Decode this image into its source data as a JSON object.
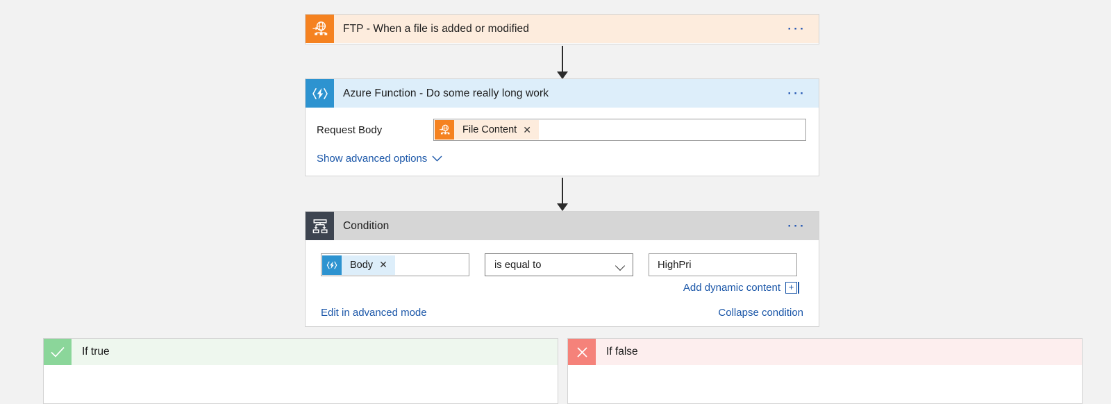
{
  "canvas": {
    "background_color": "#f2f2f2"
  },
  "nodes": {
    "trigger": {
      "title": "FTP - When a file is added or modified",
      "icon": "ftp-globe-icon",
      "icon_color": "#f58220",
      "header_color": "#fdecdd",
      "menu_label": "···"
    },
    "action": {
      "title": "Azure Function - Do some really long work",
      "icon": "azure-function-bolt-icon",
      "icon_color": "#2d93d0",
      "header_color": "#ddeefa",
      "menu_label": "···",
      "request_body_label": "Request Body",
      "request_body_token": "File Content",
      "token_remove_label": "✕",
      "advanced_options_label": "Show advanced options"
    },
    "condition": {
      "title": "Condition",
      "icon": "condition-branch-icon",
      "icon_color": "#3d4450",
      "header_color": "#d6d6d6",
      "menu_label": "···",
      "left_token": "Body",
      "token_remove_label": "✕",
      "operator": "is equal to",
      "value": "HighPri",
      "add_dynamic_content_label": "Add dynamic content",
      "add_dynamic_content_icon": "plus-icon",
      "edit_advanced_label": "Edit in advanced mode",
      "collapse_label": "Collapse condition"
    },
    "branch_true": {
      "title": "If true",
      "icon": "check-icon",
      "icon_color": "#8bd69a",
      "header_color": "#eef7ee"
    },
    "branch_false": {
      "title": "If false",
      "icon": "cross-icon",
      "icon_color": "#f5827a",
      "header_color": "#fdeeee"
    }
  }
}
